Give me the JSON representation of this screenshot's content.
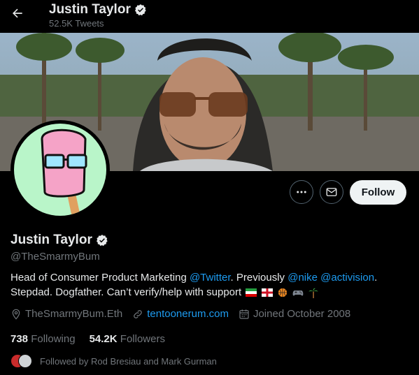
{
  "header": {
    "name": "Justin Taylor",
    "tweets": "52.5K Tweets"
  },
  "profile": {
    "name": "Justin Taylor",
    "handle": "@TheSmarmyBum",
    "bio": {
      "t1": "Head of Consumer Product Marketing ",
      "m1": "@Twitter",
      "t2": ". Previously ",
      "m2": "@nike",
      "t3": " ",
      "m3": "@activision",
      "t4": ".",
      "line2": "Stepdad. Dogfather. Can’t verify/help with support"
    },
    "location": "TheSmarmyBum.Eth",
    "website": "tentoonerum.com",
    "joined": "Joined October 2008",
    "following_count": "738",
    "following_label": "Following",
    "followers_count": "54.2K",
    "followers_label": "Followers",
    "followed_by": "Followed by Rod Bresiau and Mark Gurman"
  },
  "actions": {
    "follow_label": "Follow"
  },
  "colors": {
    "accent": "#1d9bf0",
    "muted": "#71767b",
    "background": "#000000"
  }
}
